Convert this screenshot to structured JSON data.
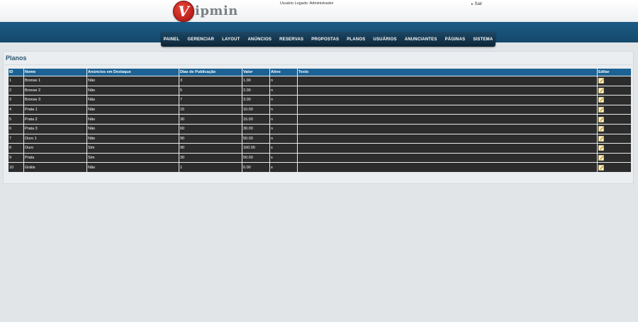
{
  "header": {
    "logo_initial": "V",
    "logo_rest": "ipmin",
    "user_logged": "Usuário Logado: Administrador",
    "logout_label": "Sair"
  },
  "nav": {
    "items": [
      "PAINEL",
      "GERENCIAR",
      "LAYOUT",
      "ANÚNCIOS",
      "RESERVAS",
      "PROPOSTAS",
      "PLANOS",
      "USUÁRIOS",
      "ANUNCIANTES",
      "PÁGINAS",
      "SISTEMA"
    ]
  },
  "page": {
    "title": "Planos"
  },
  "table": {
    "columns": [
      "ID",
      "Nome",
      "Anúncios em Destaque",
      "Dias de Publicação",
      "Valor",
      "Ativo",
      "Texto",
      "Editar"
    ],
    "rows": [
      [
        "1",
        "Bronse 1",
        "Não",
        "3",
        "1.00",
        "n",
        ""
      ],
      [
        "2",
        "Bronse 2",
        "Não",
        "5",
        "2.00",
        "n",
        ""
      ],
      [
        "3",
        "Bronse 3",
        "Não",
        "7",
        "3.00",
        "n",
        ""
      ],
      [
        "4",
        "Prata 1",
        "Não",
        "15",
        "10.00",
        "n",
        ""
      ],
      [
        "5",
        "Prata 2",
        "Não",
        "30",
        "15.00",
        "n",
        ""
      ],
      [
        "6",
        "Prata 3",
        "Não",
        "60",
        "30.00",
        "n",
        ""
      ],
      [
        "7",
        "Ouro 1",
        "Não",
        "90",
        "50.00",
        "n",
        ""
      ],
      [
        "8",
        "Ouro",
        "Sim",
        "90",
        "160.00",
        "s",
        ""
      ],
      [
        "9",
        "Prata",
        "Sim",
        "30",
        "50.00",
        "s",
        ""
      ],
      [
        "10",
        "Grátis",
        "Não",
        "1",
        "0.00",
        "s",
        ""
      ]
    ]
  },
  "colors": {
    "nav_band": "#1c5b85",
    "table_header": "#1c6294",
    "table_row": "#2c2c2c",
    "title": "#2a5670"
  },
  "icons": {
    "edit": "pencil-edit-icon"
  }
}
